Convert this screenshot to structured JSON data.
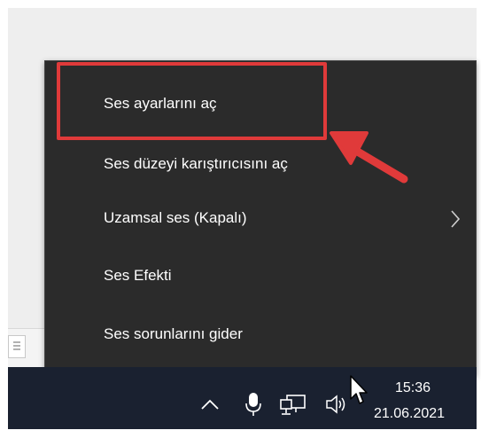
{
  "context_menu": {
    "items": [
      {
        "label": "Ses ayarlarını aç"
      },
      {
        "label": "Ses düzeyi karıştırıcısını aç"
      },
      {
        "label": "Uzamsal ses (Kapalı)",
        "has_submenu": true
      },
      {
        "label": "Ses Efekti"
      },
      {
        "label": "Ses sorunlarını gider"
      }
    ]
  },
  "annotation": {
    "highlight_color": "#e03a3a",
    "target": "Ses ayarlarını aç"
  },
  "taskbar": {
    "tray_icons": [
      "chevron-up-icon",
      "microphone-icon",
      "network-icon",
      "speaker-icon"
    ],
    "time": "15:36",
    "date": "21.06.2021"
  }
}
